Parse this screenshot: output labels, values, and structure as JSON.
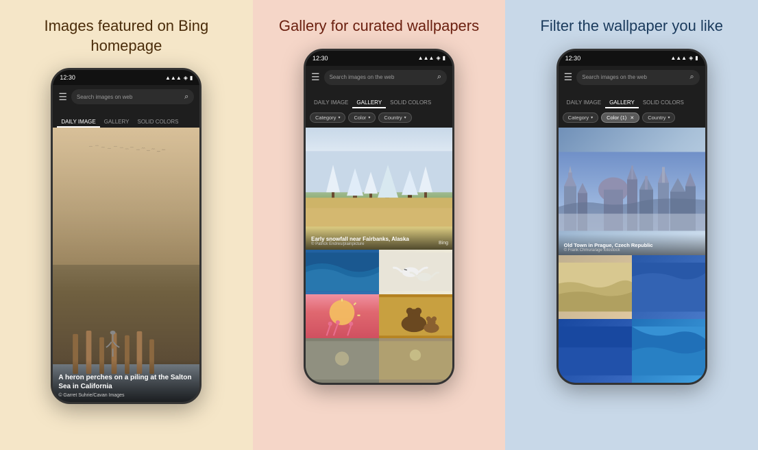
{
  "panels": [
    {
      "id": "panel-1",
      "title": "Images featured\non Bing homepage",
      "bg": "#f5e6c8",
      "titleColor": "#4a2c0a",
      "phone": {
        "time": "12:30",
        "searchPlaceholder": "Search images on web",
        "tabs": [
          {
            "label": "DAILY IMAGE",
            "active": true
          },
          {
            "label": "GALLERY",
            "active": false
          },
          {
            "label": "SOLID COLORS",
            "active": false
          }
        ],
        "dailyImage": {
          "caption": "A heron perches on a piling at the Salton Sea in California",
          "credit": "© Garret Suhrie/Cavan Images"
        }
      }
    },
    {
      "id": "panel-2",
      "title": "Gallery for curated\nwallpapers",
      "bg": "#f5d6c8",
      "titleColor": "#6b2010",
      "phone": {
        "time": "12:30",
        "searchPlaceholder": "Search images on the web",
        "tabs": [
          {
            "label": "DAILY IMAGE",
            "active": false
          },
          {
            "label": "GALLERY",
            "active": true
          },
          {
            "label": "SOLID COLORS",
            "active": false
          }
        ],
        "filters": [
          {
            "label": "Category",
            "hasChevron": true
          },
          {
            "label": "Color",
            "hasChevron": true
          },
          {
            "label": "Country",
            "hasChevron": true
          }
        ],
        "galleryMain": {
          "title": "Early snowfall near Fairbanks, Alaska",
          "credit": "© Patrick Endres/plainpicture"
        }
      }
    },
    {
      "id": "panel-3",
      "title": "Filter the wallpaper\nyou like",
      "bg": "#c8d8e8",
      "titleColor": "#1a3a5c",
      "phone": {
        "time": "12:30",
        "searchPlaceholder": "Search images on the web",
        "tabs": [
          {
            "label": "DAILY IMAGE",
            "active": false
          },
          {
            "label": "GALLERY",
            "active": true
          },
          {
            "label": "SOLID COLORS",
            "active": false
          }
        ],
        "filters": [
          {
            "label": "Category",
            "hasChevron": true,
            "active": false
          },
          {
            "label": "Color (1)",
            "hasChevron": false,
            "active": true,
            "hasX": true
          },
          {
            "label": "Country",
            "hasChevron": true,
            "active": false
          }
        ],
        "filterMain": {
          "title": "Old Town in Prague, Czech Republic",
          "credit": "© Frank Chmura/age fotostock"
        }
      }
    }
  ],
  "icons": {
    "hamburger": "☰",
    "search": "🔍",
    "signal": "▲",
    "wifi": "▲",
    "battery": "▮",
    "chevronDown": "▾",
    "close": "✕"
  }
}
